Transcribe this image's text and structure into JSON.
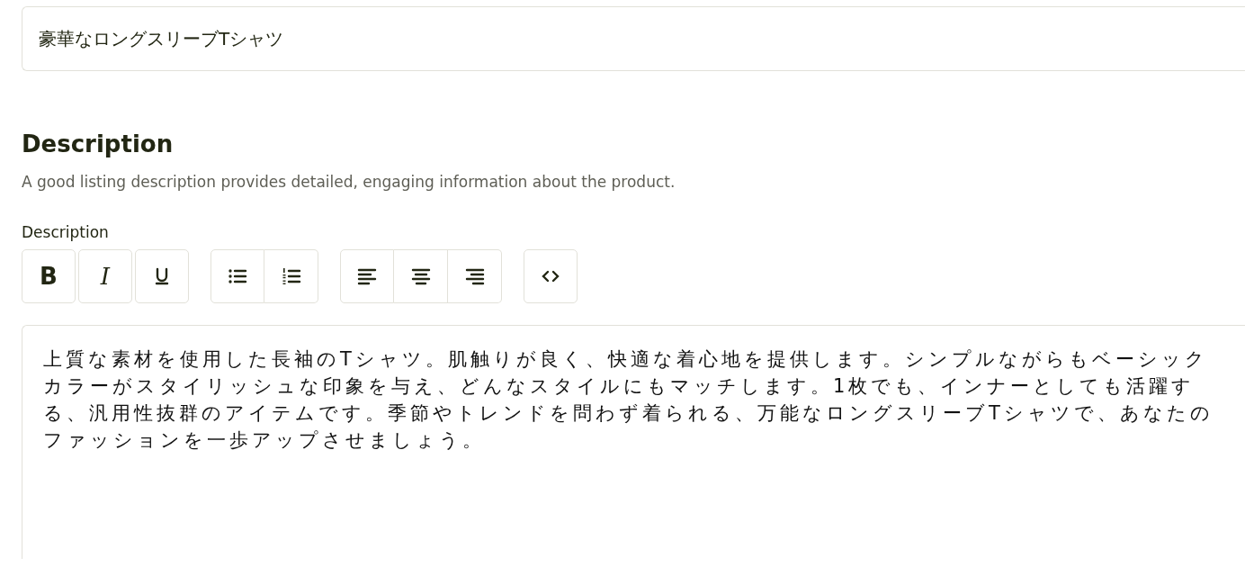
{
  "title_field": {
    "value": "豪華なロングスリーブTシャツ"
  },
  "section": {
    "heading": "Description",
    "hint": "A good listing description provides detailed, engaging information about the product."
  },
  "editor": {
    "label": "Description",
    "toolbar": [
      {
        "joined": false,
        "buttons": [
          {
            "kind": "bold",
            "text": "B"
          },
          {
            "kind": "italic",
            "text": "I"
          },
          {
            "kind": "underline"
          }
        ]
      },
      {
        "joined": true,
        "buttons": [
          {
            "kind": "bullet-list"
          },
          {
            "kind": "numbered-list"
          }
        ]
      },
      {
        "joined": true,
        "buttons": [
          {
            "kind": "align-left"
          },
          {
            "kind": "align-center"
          },
          {
            "kind": "align-right"
          }
        ]
      },
      {
        "joined": false,
        "buttons": [
          {
            "kind": "code"
          }
        ]
      }
    ],
    "content": "上質な素材を使用した長袖のTシャツ。肌触りが良く、快適な着心地を提供します。シンプルながらもベーシックカラーがスタイリッシュな印象を与え、どんなスタイルにもマッチします。1枚でも、インナーとしても活躍する、汎用性抜群のアイテムです。季節やトレンドを問わず着られる、万能なロングスリーブTシャツで、あなたのファッションを一歩アップさせましょう。"
  }
}
